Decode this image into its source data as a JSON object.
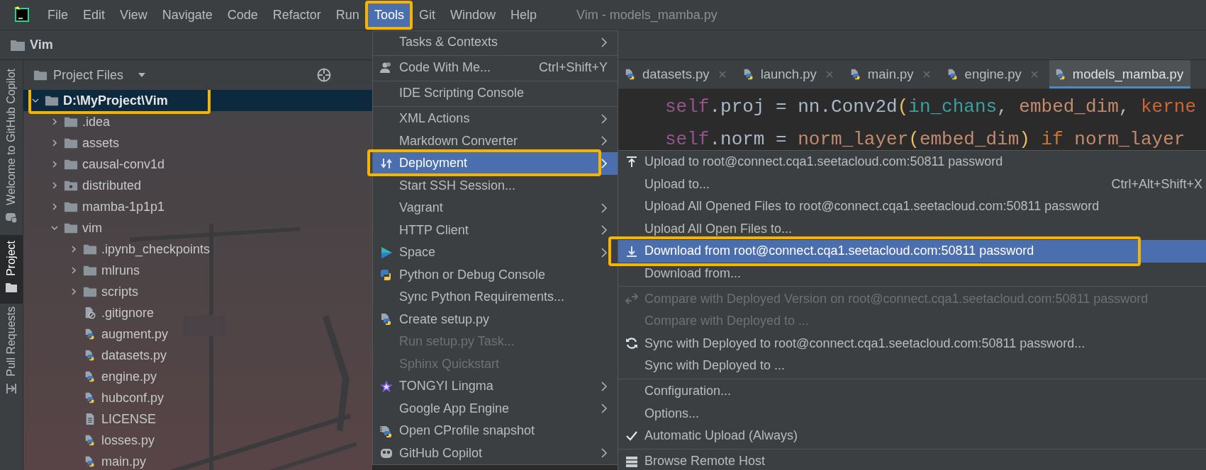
{
  "window": {
    "title": "Vim - models_mamba.py"
  },
  "menubar": {
    "items": [
      {
        "label": "File",
        "selected": false,
        "highlighted": false
      },
      {
        "label": "Edit",
        "selected": false,
        "highlighted": false
      },
      {
        "label": "View",
        "selected": false,
        "highlighted": false
      },
      {
        "label": "Navigate",
        "selected": false,
        "highlighted": false
      },
      {
        "label": "Code",
        "selected": false,
        "highlighted": false
      },
      {
        "label": "Refactor",
        "selected": false,
        "highlighted": false
      },
      {
        "label": "Run",
        "selected": false,
        "highlighted": false
      },
      {
        "label": "Tools",
        "selected": true,
        "highlighted": true
      },
      {
        "label": "Git",
        "selected": false,
        "highlighted": false
      },
      {
        "label": "Window",
        "selected": false,
        "highlighted": false
      },
      {
        "label": "Help",
        "selected": false,
        "highlighted": false
      }
    ]
  },
  "navbar": {
    "project": "Vim"
  },
  "side_strip": {
    "tabs": [
      {
        "label": "Welcome to GitHub Copilot",
        "kind": "copilot",
        "selected": false
      },
      {
        "label": "Project",
        "kind": "project",
        "selected": true
      },
      {
        "label": "Pull Requests",
        "kind": "pulls",
        "selected": false
      }
    ]
  },
  "project_panel": {
    "view": "Project Files",
    "tree": [
      {
        "name": "D:\\MyProject\\Vim",
        "kind": "folder",
        "expanded": true,
        "selected": true,
        "highlighted": true,
        "children": [
          {
            "name": ".idea",
            "kind": "folder",
            "expanded": false,
            "selected": false,
            "highlighted": false
          },
          {
            "name": "assets",
            "kind": "folder",
            "expanded": false,
            "selected": false,
            "highlighted": false
          },
          {
            "name": "causal-conv1d",
            "kind": "folder",
            "expanded": false,
            "selected": false,
            "highlighted": false
          },
          {
            "name": "distributed",
            "kind": "package",
            "expanded": false,
            "selected": false,
            "highlighted": false
          },
          {
            "name": "mamba-1p1p1",
            "kind": "folder",
            "expanded": false,
            "selected": false,
            "highlighted": false
          },
          {
            "name": "vim",
            "kind": "folder",
            "expanded": true,
            "selected": false,
            "highlighted": false,
            "children": [
              {
                "name": ".ipynb_checkpoints",
                "kind": "folder",
                "expanded": false,
                "selected": false,
                "highlighted": false
              },
              {
                "name": "mlruns",
                "kind": "folder",
                "expanded": false,
                "selected": false,
                "highlighted": false
              },
              {
                "name": "scripts",
                "kind": "folder",
                "expanded": false,
                "selected": false,
                "highlighted": false
              },
              {
                "name": ".gitignore",
                "kind": "ignore",
                "selected": false,
                "highlighted": false
              },
              {
                "name": "augment.py",
                "kind": "python",
                "selected": false,
                "highlighted": false
              },
              {
                "name": "datasets.py",
                "kind": "python",
                "selected": false,
                "highlighted": false
              },
              {
                "name": "engine.py",
                "kind": "python",
                "selected": false,
                "highlighted": false
              },
              {
                "name": "hubconf.py",
                "kind": "python",
                "selected": false,
                "highlighted": false
              },
              {
                "name": "LICENSE",
                "kind": "text",
                "selected": false,
                "highlighted": false
              },
              {
                "name": "losses.py",
                "kind": "python",
                "selected": false,
                "highlighted": false
              },
              {
                "name": "main.py",
                "kind": "python",
                "selected": false,
                "highlighted": false
              }
            ]
          }
        ]
      }
    ]
  },
  "editor": {
    "tabs": [
      {
        "label": "datasets.py",
        "selected": false
      },
      {
        "label": "launch.py",
        "selected": false
      },
      {
        "label": "main.py",
        "selected": false
      },
      {
        "label": "engine.py",
        "selected": false
      },
      {
        "label": "models_mamba.py",
        "selected": true
      }
    ],
    "code": [
      [
        {
          "text": "self",
          "kind": "self"
        },
        {
          "text": ".proj = nn.Conv2d",
          "kind": "plain"
        },
        {
          "text": "(",
          "kind": "paren"
        },
        {
          "text": "in_chans",
          "kind": "param"
        },
        {
          "text": ", ",
          "kind": "plain"
        },
        {
          "text": "embed_dim",
          "kind": "arg"
        },
        {
          "text": ", ",
          "kind": "plain"
        },
        {
          "text": "kerne",
          "kind": "kwarg"
        }
      ],
      [
        {
          "text": "self",
          "kind": "self"
        },
        {
          "text": ".norm = ",
          "kind": "plain"
        },
        {
          "text": "norm_layer",
          "kind": "arg"
        },
        {
          "text": "(",
          "kind": "paren"
        },
        {
          "text": "embed_dim",
          "kind": "arg"
        },
        {
          "text": ") ",
          "kind": "paren"
        },
        {
          "text": "if ",
          "kind": "keyword"
        },
        {
          "text": "norm_layer",
          "kind": "arg"
        }
      ]
    ]
  },
  "tools_menu": {
    "items": [
      {
        "label": "Tasks & Contexts",
        "kind": "plain",
        "submenu": true,
        "disabled": false,
        "selected": false,
        "highlighted": false,
        "separator_after": true
      },
      {
        "label": "Code With Me...",
        "shortcut": "Ctrl+Shift+Y",
        "kind": "people",
        "submenu": false,
        "disabled": false,
        "selected": false,
        "highlighted": false,
        "separator_after": true
      },
      {
        "label": "IDE Scripting Console",
        "kind": "plain",
        "submenu": false,
        "disabled": false,
        "selected": false,
        "highlighted": false,
        "separator_after": true
      },
      {
        "label": "XML Actions",
        "kind": "plain",
        "submenu": true,
        "disabled": false,
        "selected": false,
        "highlighted": false,
        "separator_after": false
      },
      {
        "label": "Markdown Converter",
        "kind": "plain",
        "submenu": true,
        "disabled": false,
        "selected": false,
        "highlighted": false,
        "separator_after": false
      },
      {
        "label": "Deployment",
        "kind": "deploy",
        "submenu": true,
        "disabled": false,
        "selected": true,
        "highlighted": true,
        "separator_after": false
      },
      {
        "label": "Start SSH Session...",
        "kind": "plain",
        "submenu": false,
        "disabled": false,
        "selected": false,
        "highlighted": false,
        "separator_after": false
      },
      {
        "label": "Vagrant",
        "kind": "plain",
        "submenu": true,
        "disabled": false,
        "selected": false,
        "highlighted": false,
        "separator_after": false
      },
      {
        "label": "HTTP Client",
        "kind": "plain",
        "submenu": true,
        "disabled": false,
        "selected": false,
        "highlighted": false,
        "separator_after": false
      },
      {
        "label": "Space",
        "kind": "space",
        "submenu": true,
        "disabled": false,
        "selected": false,
        "highlighted": false,
        "separator_after": false
      },
      {
        "label": "Python or Debug Console",
        "kind": "python",
        "submenu": false,
        "disabled": false,
        "selected": false,
        "highlighted": false,
        "separator_after": false
      },
      {
        "label": "Sync Python Requirements...",
        "kind": "plain",
        "submenu": false,
        "disabled": false,
        "selected": false,
        "highlighted": false,
        "separator_after": false
      },
      {
        "label": "Create setup.py",
        "kind": "setup",
        "submenu": false,
        "disabled": false,
        "selected": false,
        "highlighted": false,
        "separator_after": false
      },
      {
        "label": "Run setup.py Task...",
        "kind": "plain",
        "submenu": false,
        "disabled": true,
        "selected": false,
        "highlighted": false,
        "separator_after": false
      },
      {
        "label": "Sphinx Quickstart",
        "kind": "plain",
        "submenu": false,
        "disabled": true,
        "selected": false,
        "highlighted": false,
        "separator_after": false
      },
      {
        "label": "TONGYI Lingma",
        "kind": "star",
        "submenu": true,
        "disabled": false,
        "selected": false,
        "highlighted": false,
        "separator_after": false
      },
      {
        "label": "Google App Engine",
        "kind": "plain",
        "submenu": true,
        "disabled": false,
        "selected": false,
        "highlighted": false,
        "separator_after": false
      },
      {
        "label": "Open CProfile snapshot",
        "kind": "profile",
        "submenu": false,
        "disabled": false,
        "selected": false,
        "highlighted": false,
        "separator_after": false
      },
      {
        "label": "GitHub Copilot",
        "kind": "goggles",
        "submenu": true,
        "disabled": false,
        "selected": false,
        "highlighted": false,
        "separator_after": false
      }
    ]
  },
  "deployment_menu": {
    "items": [
      {
        "label": "Upload to root@connect.cqa1.seetacloud.com:50811 password",
        "kind": "upload",
        "disabled": false,
        "checked": false,
        "selected": false,
        "highlighted": false,
        "separator_after": false
      },
      {
        "label": "Upload to...",
        "shortcut": "Ctrl+Alt+Shift+X",
        "kind": "plain",
        "disabled": false,
        "checked": false,
        "selected": false,
        "highlighted": false,
        "separator_after": false
      },
      {
        "label": "Upload All Opened Files to root@connect.cqa1.seetacloud.com:50811 password",
        "kind": "plain",
        "disabled": false,
        "checked": false,
        "selected": false,
        "highlighted": false,
        "separator_after": false
      },
      {
        "label": "Upload All Open Files to...",
        "kind": "plain",
        "disabled": false,
        "checked": false,
        "selected": false,
        "highlighted": false,
        "separator_after": false
      },
      {
        "label": "Download from root@connect.cqa1.seetacloud.com:50811 password",
        "kind": "download",
        "disabled": false,
        "checked": false,
        "selected": true,
        "highlighted": true,
        "separator_after": false
      },
      {
        "label": "Download from...",
        "kind": "plain",
        "disabled": false,
        "checked": false,
        "selected": false,
        "highlighted": false,
        "separator_after": true
      },
      {
        "label": "Compare with Deployed Version on root@connect.cqa1.seetacloud.com:50811 password",
        "kind": "compare",
        "disabled": true,
        "checked": false,
        "selected": false,
        "highlighted": false,
        "separator_after": false
      },
      {
        "label": "Compare with Deployed to ...",
        "kind": "plain",
        "disabled": true,
        "checked": false,
        "selected": false,
        "highlighted": false,
        "separator_after": false
      },
      {
        "label": "Sync with Deployed to root@connect.cqa1.seetacloud.com:50811 password...",
        "kind": "sync",
        "disabled": false,
        "checked": false,
        "selected": false,
        "highlighted": false,
        "separator_after": false
      },
      {
        "label": "Sync with Deployed to ...",
        "kind": "plain",
        "disabled": false,
        "checked": false,
        "selected": false,
        "highlighted": false,
        "separator_after": true
      },
      {
        "label": "Configuration...",
        "kind": "plain",
        "disabled": false,
        "checked": false,
        "selected": false,
        "highlighted": false,
        "separator_after": false
      },
      {
        "label": "Options...",
        "kind": "plain",
        "disabled": false,
        "checked": false,
        "selected": false,
        "highlighted": false,
        "separator_after": false
      },
      {
        "label": "Automatic Upload (Always)",
        "kind": "plain",
        "disabled": false,
        "checked": true,
        "selected": false,
        "highlighted": false,
        "separator_after": true
      },
      {
        "label": "Browse Remote Host",
        "kind": "server",
        "disabled": false,
        "checked": false,
        "selected": false,
        "highlighted": false,
        "separator_after": false
      }
    ]
  }
}
